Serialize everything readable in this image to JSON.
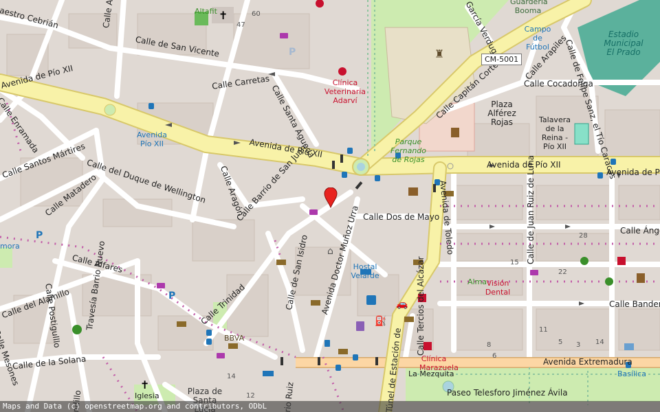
{
  "map": {
    "attribution": "Maps and Data (c) openstreetmap.org and contributors, ODbL",
    "road_shield": "CM-5001",
    "streets": {
      "avenida_pio_xii_west": "Avenida de Pío XII",
      "avenida_pio_xii_mid": "Avenida de Pío XII",
      "avenida_pio_xii_east": "Avenida de Pío XII",
      "avenida_pio_east2": "Avenida de Pío",
      "maestro_cebrian": "aestro Cebrián",
      "alferez_provisional": "Calle Alférez Provis",
      "san_vicente": "Calle de San Vicente",
      "carretas": "Calle Carretas",
      "santa_agueda": "Calle Santa Águeda",
      "enramada": "Calle Enramada",
      "santos_martires": "Calle Santos Mártires",
      "matadero": "Calle Matadero",
      "duque_wellington": "Calle del Duque de Wellington",
      "aragon": "Calle Aragón",
      "barrio_san_juan": "Calle Barrio de San Juan",
      "dos_de_mayo": "Calle Dos de Mayo",
      "doctor_munoz_urra": "Avenida Doctor Muñoz Urra",
      "avenida_toledo": "Avenida de Toledo",
      "juan_ruiz_luna": "Calle de Juan Ruiz de Luna",
      "trinidad": "Calle Trinidad",
      "san_isidro": "Calle de San Isidro",
      "alfares": "Calle Alfares",
      "alamillo": "Calle del Alamillo",
      "postigulllo": "Calle Postigulllo",
      "travesia_barrio_nuevo": "Travesía Barrio Nuevo",
      "mesones": "Calle Mesones",
      "solana": "Calle de la Solana",
      "tercios_alcazar": "Calle Tercios del Alcázar",
      "tunel_estacion": "Túnel de Estación de",
      "avenida_extremadura": "Avenida Extremadura",
      "paseo_telesforo": "Paseo Telesforo Jiménez Ávila",
      "capitan_cortes": "Calle Capitán Cortés",
      "garcia_verdugo": "García Verdugo",
      "arapiles": "Calle Arapiles",
      "felipe_sanz": "Calle de Felipe Sanz, el Tío Caracas",
      "cocadonga": "Calle Cocadonga",
      "angel": "Calle Ángel",
      "banderas": "Calle Banderas",
      "ruiz": "rio Ruiz",
      "nidillo": "ndillo"
    },
    "pois": {
      "altafit": "Altafit",
      "clinica_veterinaria": "Clínica Veterinaria Adarví",
      "avenida_pio_stop": "Avenida Pío XII",
      "parque": "Parque Fernando de Rojas",
      "plaza_alferez": "Plaza Alférez Rojas",
      "talavera_reina": "Talavera de la Reina - Pío XII",
      "campo_futbol": "Campo de Fútbol",
      "guarderia": "Guardería Booma",
      "estadio": "Estadio Municipal El Prado",
      "hostal": "Hostal Velarde",
      "bbva": "BBVA",
      "alma": "Alma",
      "vision_dental": "Visión Dental",
      "clinica_marazuela": "Clínica Marazuela",
      "la_mezquita": "La Mezquita",
      "basilica": "Basílica",
      "iglesia": "Iglesia",
      "plaza_santa_lucia": "Plaza de Santa Lucía",
      "mora": "mora"
    },
    "house_numbers": {
      "n60": "60",
      "n47": "47",
      "n28": "28",
      "n15": "15",
      "n22": "22",
      "n11": "11",
      "n8": "8",
      "n5": "5",
      "n3": "3",
      "n14": "14",
      "n12": "12",
      "n6": "6",
      "n14b": "14"
    },
    "colors": {
      "background": "#e0d9d3",
      "building": "#d9d0c9",
      "primary_road": "#f8f2a8",
      "primary_casing": "#d8c86a",
      "secondary_road": "#fcd6a4",
      "residential": "#ffffff",
      "park": "#cdebb0",
      "pitch": "#2fa38a",
      "transit": "#1f75b8",
      "health": "#c8102e",
      "marker": "#e8231f"
    }
  }
}
